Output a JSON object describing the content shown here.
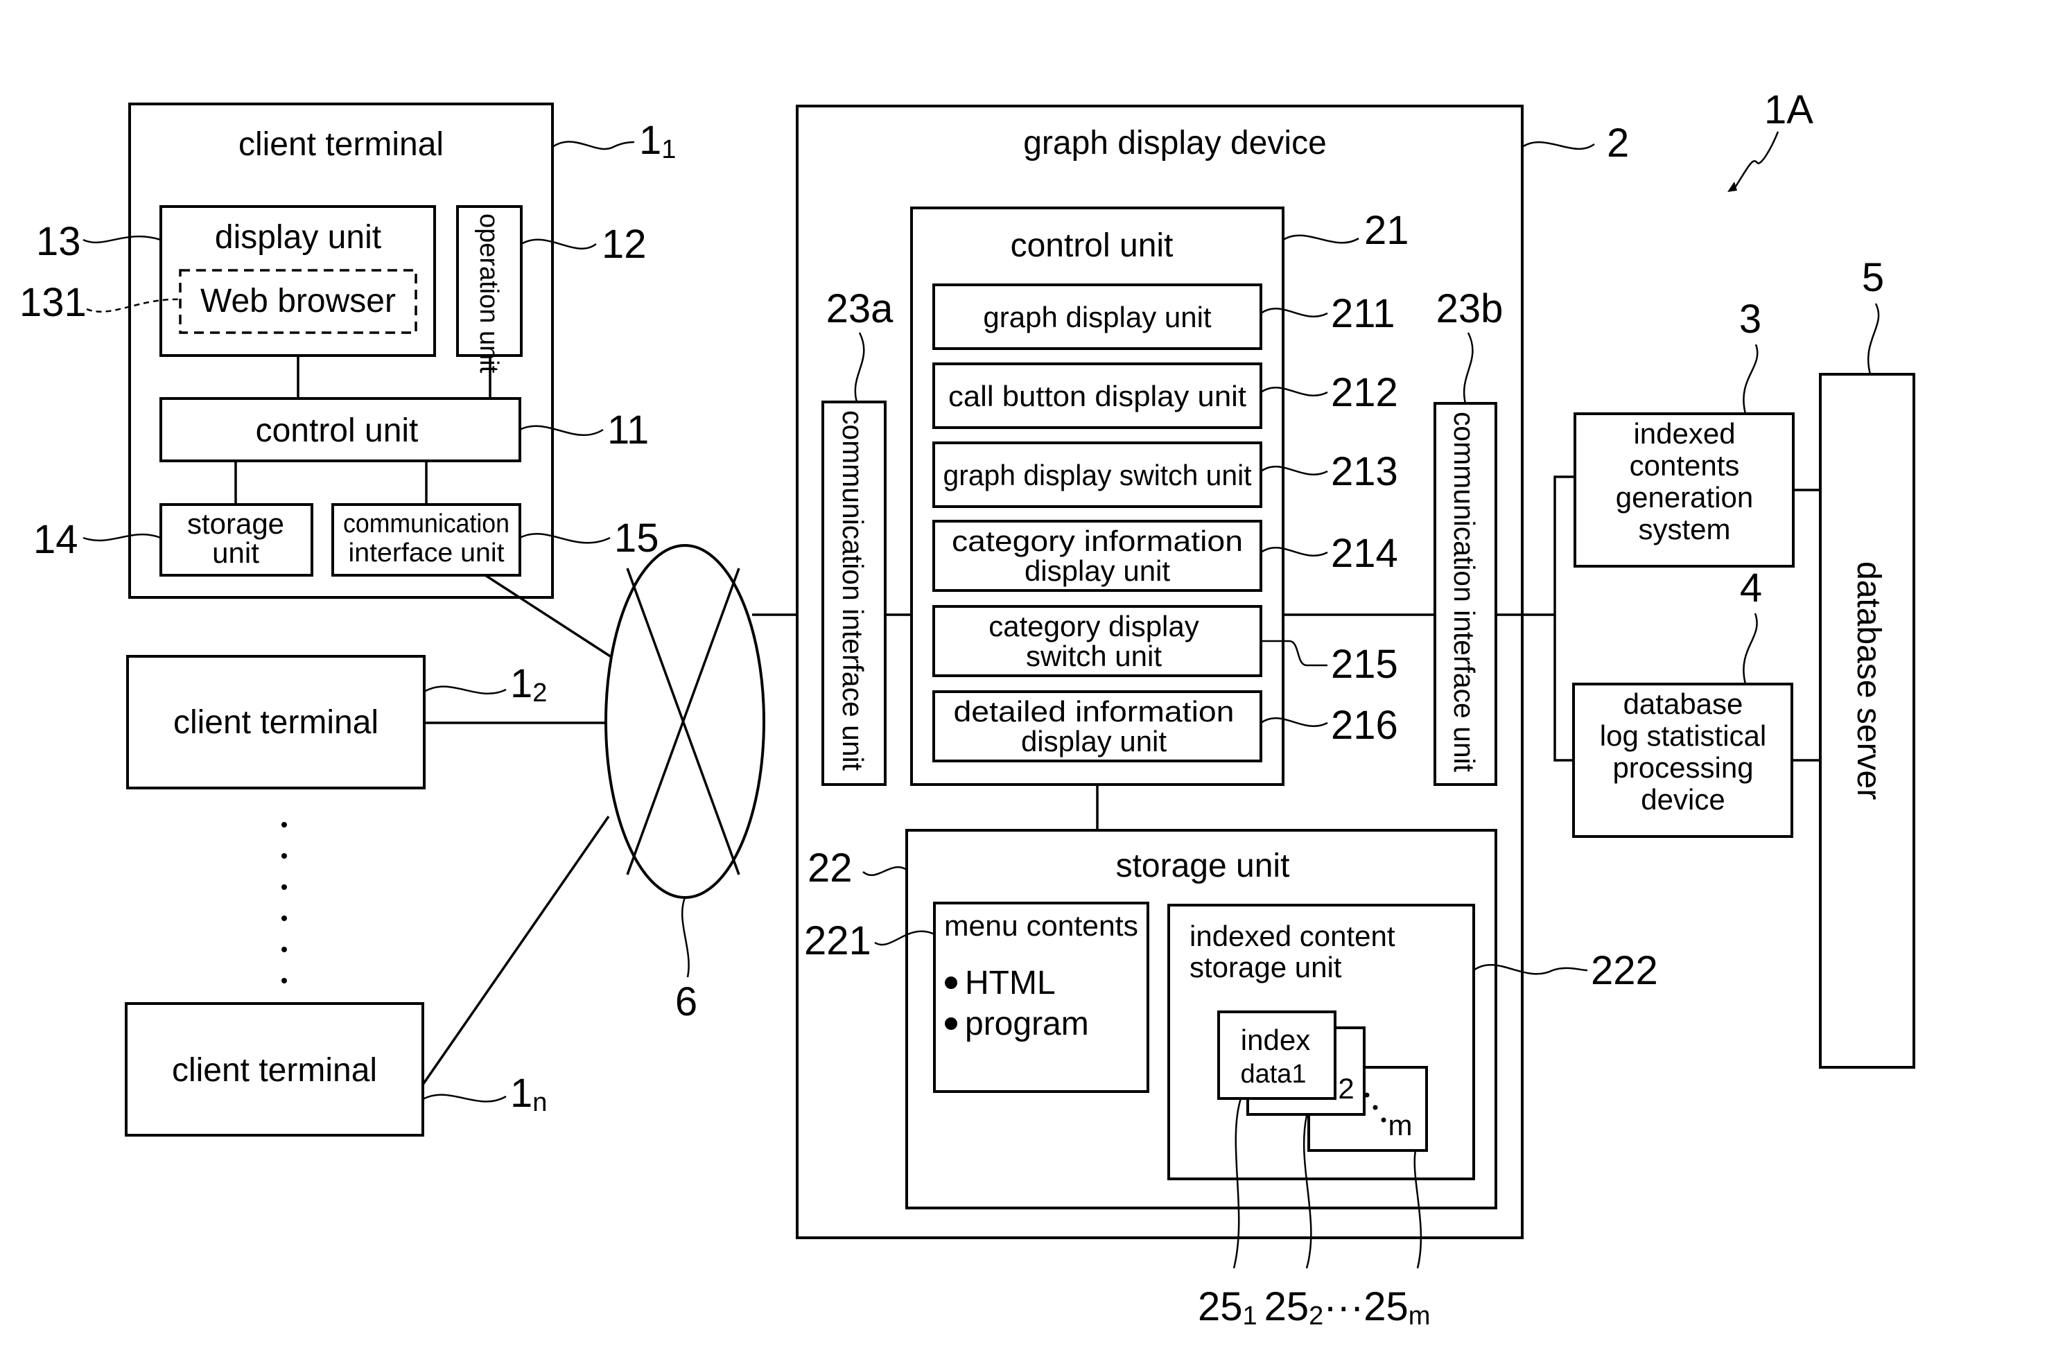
{
  "figure": {
    "system_ref": "1A"
  },
  "client_terminals": [
    {
      "title": "client terminal",
      "ref": "1",
      "ref_sub": "1",
      "components": {
        "display_unit": {
          "label": "display unit",
          "ref": "13"
        },
        "web_browser": {
          "label": "Web browser",
          "ref": "131"
        },
        "operation_unit": {
          "label": "operation unit",
          "ref": "12"
        },
        "control_unit": {
          "label": "control unit",
          "ref": "11"
        },
        "storage_unit": {
          "label_lines": [
            "storage",
            "unit"
          ],
          "ref": "14"
        },
        "communication_interface_unit": {
          "label_lines": [
            "communication",
            "interface unit"
          ],
          "ref": "15"
        }
      }
    },
    {
      "title": "client terminal",
      "ref": "1",
      "ref_sub": "2"
    },
    {
      "title": "client terminal",
      "ref": "1",
      "ref_sub": "n"
    }
  ],
  "network": {
    "ref": "6"
  },
  "graph_display_device": {
    "title": "graph display device",
    "ref": "2",
    "comm_interface_a": {
      "label": "communication interface unit",
      "ref": "23a"
    },
    "comm_interface_b": {
      "label": "communication interface unit",
      "ref": "23b"
    },
    "control_unit": {
      "title": "control unit",
      "ref": "21",
      "units": [
        {
          "lines": [
            "graph display unit"
          ],
          "ref": "211"
        },
        {
          "lines": [
            "call button display unit"
          ],
          "ref": "212"
        },
        {
          "lines": [
            "graph display switch unit"
          ],
          "ref": "213"
        },
        {
          "lines": [
            "category information",
            "display unit"
          ],
          "ref": "214"
        },
        {
          "lines": [
            "category display",
            "switch unit"
          ],
          "ref": "215"
        },
        {
          "lines": [
            "detailed information",
            "display unit"
          ],
          "ref": "216"
        }
      ]
    },
    "storage_unit": {
      "title": "storage unit",
      "ref": "22",
      "menu_contents": {
        "title": "menu contents",
        "ref": "221",
        "items": [
          "HTML",
          "program"
        ]
      },
      "indexed_content_storage": {
        "title_lines": [
          "indexed content",
          "storage unit"
        ],
        "ref": "222",
        "index_data": {
          "front_lines": [
            "index",
            "data1"
          ],
          "second": "2",
          "last": "m",
          "refs": [
            {
              "base": "25",
              "sub": "1"
            },
            {
              "base": "25",
              "sub": "2"
            },
            {
              "base": "25",
              "sub": "m"
            }
          ],
          "ellipsis": "···"
        }
      }
    }
  },
  "indexed_contents_generation_system": {
    "lines": [
      "indexed",
      "contents",
      "generation",
      "system"
    ],
    "ref": "3"
  },
  "database_log_statistical_processing_device": {
    "lines": [
      "database",
      "log statistical",
      "processing",
      "device"
    ],
    "ref": "4"
  },
  "database_server": {
    "label": "database server",
    "ref": "5"
  }
}
